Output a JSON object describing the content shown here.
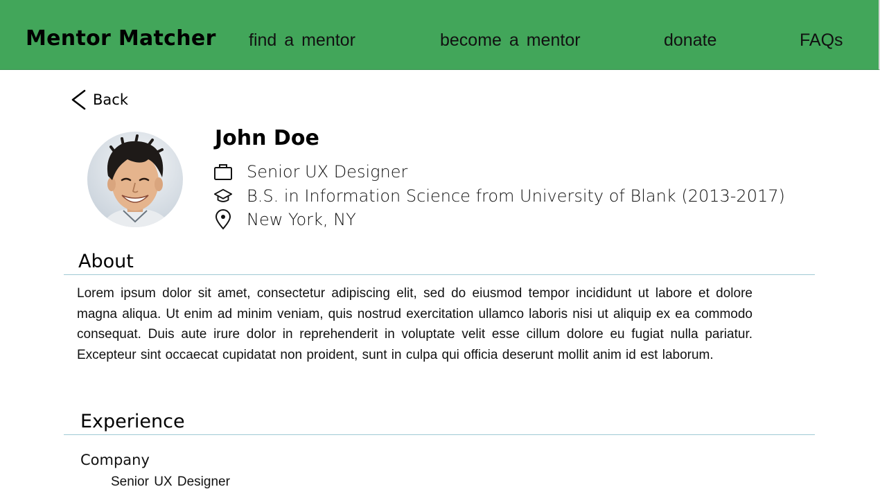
{
  "header": {
    "brand": "Mentor Matcher",
    "nav": {
      "find": "find a mentor",
      "become": "become a mentor",
      "donate": "donate",
      "faqs": "FAQs"
    },
    "bg_color": "#42a65a"
  },
  "back": {
    "label": "Back",
    "icon": "chevron-left-icon"
  },
  "profile": {
    "name": "John Doe",
    "job": "Senior UX Designer",
    "education": "B.S. in Information Science from University of Blank (2013-2017)",
    "location": "New York, NY",
    "icons": {
      "job": "briefcase-icon",
      "education": "graduation-cap-icon",
      "location": "map-pin-icon"
    }
  },
  "about": {
    "title": "About",
    "text": "Lorem ipsum dolor sit amet, consectetur adipiscing elit, sed do eiusmod tempor incididunt ut labore et dolore magna aliqua. Ut enim ad minim veniam, quis nostrud exercitation ullamco laboris nisi ut aliquip ex ea commodo consequat. Duis aute irure dolor in reprehenderit in voluptate velit esse cillum dolore eu fugiat nulla pariatur. Excepteur sint occaecat cupidatat non proident, sunt in culpa qui officia deserunt mollit anim id est laborum."
  },
  "experience": {
    "title": "Experience",
    "items": [
      {
        "company": "Company",
        "role": "Senior UX Designer"
      }
    ]
  },
  "colors": {
    "accent": "#42a65a",
    "divider": "#9fc9d4"
  }
}
